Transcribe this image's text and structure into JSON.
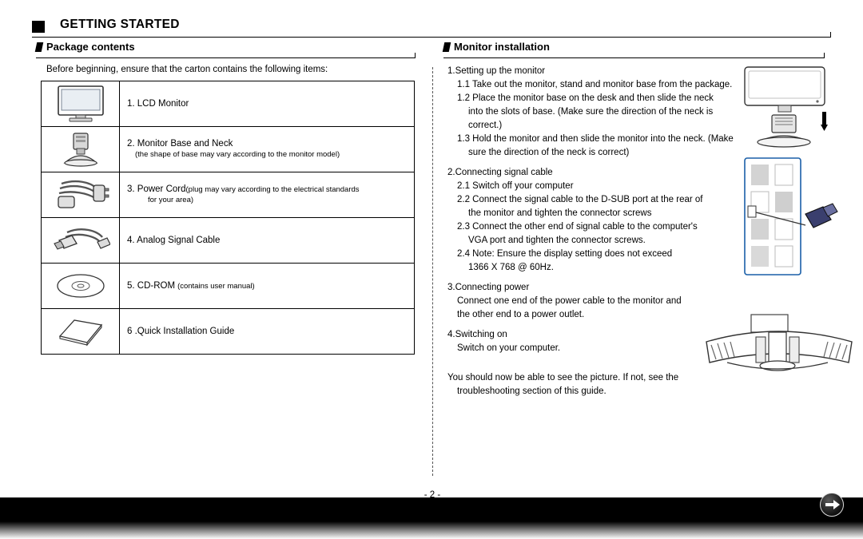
{
  "header": {
    "title": "GETTING STARTED"
  },
  "sections": {
    "package": {
      "label": "Package contents"
    },
    "monitor": {
      "label": "Monitor installation"
    }
  },
  "package": {
    "intro": "Before beginning, ensure that the carton contains the following items:",
    "items": [
      {
        "icon": "lcd-monitor-icon",
        "label": "1. LCD Monitor",
        "note": ""
      },
      {
        "icon": "monitor-base-neck-icon",
        "label": "2. Monitor Base and Neck",
        "note": "(the shape of base may vary according to the monitor model)"
      },
      {
        "icon": "power-cord-icon",
        "label": "3. Power Cord",
        "note": "(plug may vary according to the electrical standards",
        "note2": "for your area)"
      },
      {
        "icon": "analog-signal-cable-icon",
        "label": "4. Analog Signal Cable",
        "note": ""
      },
      {
        "icon": "cd-rom-icon",
        "label": "5. CD-ROM",
        "note": "(contains user manual)"
      },
      {
        "icon": "quick-installation-guide-icon",
        "label": "6 .Quick Installation Guide",
        "note": ""
      }
    ]
  },
  "installation": {
    "step1_title": "1.Setting up the monitor",
    "step1_1": "1.1 Take out the monitor, stand and monitor base from the package.",
    "step1_2a": "1.2 Place the monitor base on the desk and then slide the neck",
    "step1_2b": "into the slots of base. (Make sure the direction of the neck is",
    "step1_2c": "correct.)",
    "step1_3a": "1.3 Hold the monitor and then slide the monitor into the neck. (Make",
    "step1_3b": "sure the direction of the neck is correct)",
    "step2_title": "2.Connecting signal cable",
    "step2_1": "2.1 Switch off your computer",
    "step2_2a": "2.2 Connect the signal cable to the D-SUB port at the rear of",
    "step2_2b": "the monitor and tighten the connector screws",
    "step2_3a": "2.3 Connect the other end of signal cable to the computer's",
    "step2_3b": "VGA port and tighten the connector screws.",
    "step2_4a": "2.4 Note: Ensure the display setting does not exceed",
    "step2_4b": "1366 X 768 @ 60Hz.",
    "step3_title": "3.Connecting power",
    "step3_a": "Connect one end of the power cable to the monitor and",
    "step3_b": "the other end to a power outlet.",
    "step4_title": "4.Switching on",
    "step4_a": "Switch on your computer.",
    "closing_a": "You should now be able to see the picture. If not, see the",
    "closing_b": "troubleshooting section of this guide."
  },
  "page": {
    "number": "- 2 -"
  },
  "footer": {
    "arrow_icon": "arrow-right-icon"
  }
}
